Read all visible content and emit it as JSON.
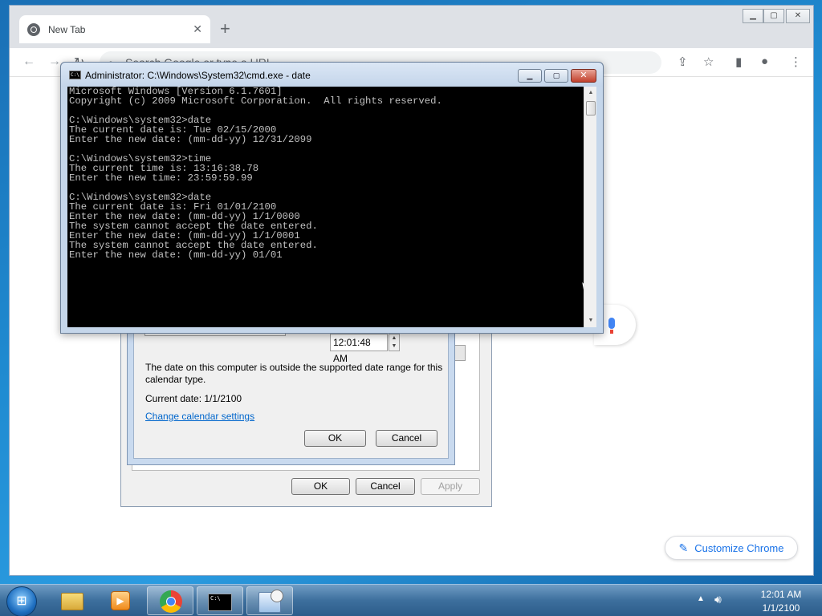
{
  "chrome": {
    "tab_title": "New Tab",
    "tab_close": "✕",
    "new_tab": "+",
    "window_min": "▁",
    "window_max": "▢",
    "window_close": "✕",
    "back": "←",
    "forward": "→",
    "reload": "↻",
    "omnibox_placeholder": "Search Google or type a URL",
    "customize_label": "Customize Chrome"
  },
  "date_time_dialog": {
    "ok_label": "OK",
    "cancel_label": "Cancel",
    "apply_label": "Apply"
  },
  "change_date_dialog": {
    "time_value": "12:01:48 AM",
    "message": "The date on this computer is outside the supported date range for this calendar type.",
    "current_date": "Current date: 1/1/2100",
    "link_label": "Change calendar settings",
    "ok_label": "OK",
    "cancel_label": "Cancel"
  },
  "cmd": {
    "title": "Administrator: C:\\Windows\\System32\\cmd.exe - date",
    "icon_text": "C:\\",
    "lines": [
      "Microsoft Windows [Version 6.1.7601]",
      "Copyright (c) 2009 Microsoft Corporation.  All rights reserved.",
      "",
      "C:\\Windows\\system32>date",
      "The current date is: Tue 02/15/2000",
      "Enter the new date: (mm-dd-yy) 12/31/2099",
      "",
      "C:\\Windows\\system32>time",
      "The current time is: 13:16:38.78",
      "Enter the new time: 23:59:59.99",
      "",
      "C:\\Windows\\system32>date",
      "The current date is: Fri 01/01/2100",
      "Enter the new date: (mm-dd-yy) 1/1/0000",
      "The system cannot accept the date entered.",
      "Enter the new date: (mm-dd-yy) 1/1/0001",
      "The system cannot accept the date entered.",
      "Enter the new date: (mm-dd-yy) 01/01"
    ]
  },
  "taskbar": {
    "clock_time": "12:01 AM",
    "clock_date": "1/1/2100"
  },
  "colors": {
    "console_bg": "#000000",
    "console_text": "#c0c0c0",
    "link": "#0066cc",
    "chrome_accent": "#1a73e8"
  }
}
